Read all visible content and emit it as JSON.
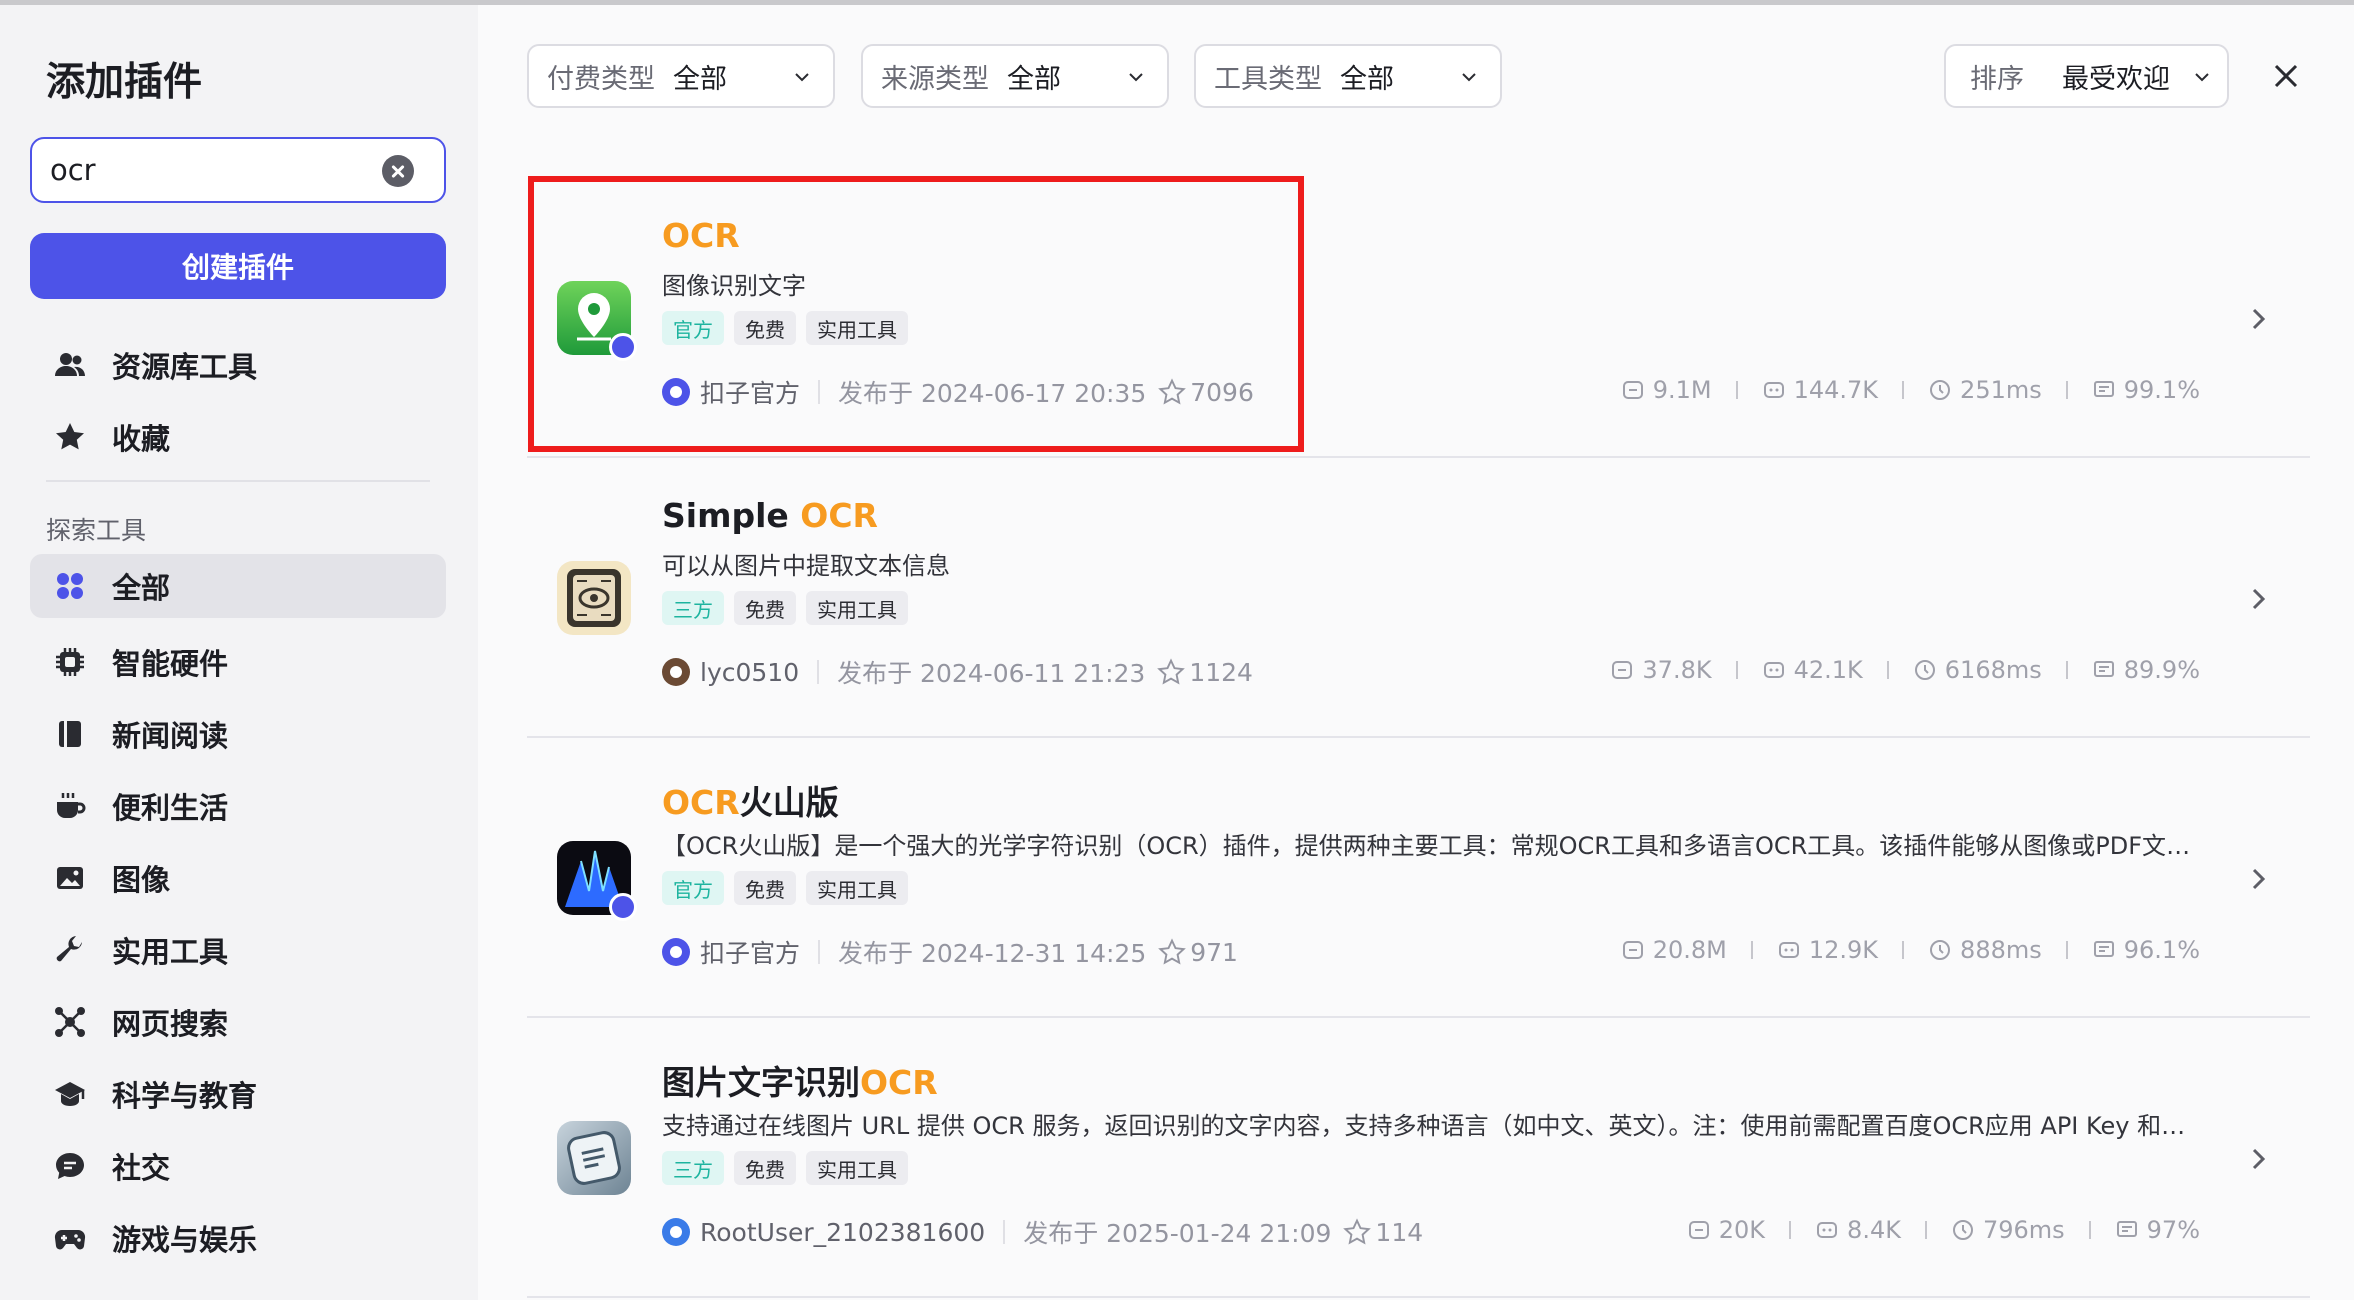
{
  "sidebar": {
    "title": "添加插件",
    "search": {
      "value": "ocr",
      "placeholder": ""
    },
    "create_button": "创建插件",
    "top_items": [
      {
        "label": "资源库工具",
        "icon": "users-icon"
      },
      {
        "label": "收藏",
        "icon": "star-icon"
      }
    ],
    "section_label": "探索工具",
    "explore_items": [
      {
        "label": "全部",
        "icon": "grid-icon",
        "active": true
      },
      {
        "label": "智能硬件",
        "icon": "chip-icon"
      },
      {
        "label": "新闻阅读",
        "icon": "book-icon"
      },
      {
        "label": "便利生活",
        "icon": "cup-icon"
      },
      {
        "label": "图像",
        "icon": "image-icon"
      },
      {
        "label": "实用工具",
        "icon": "wrench-icon"
      },
      {
        "label": "网页搜索",
        "icon": "network-icon"
      },
      {
        "label": "科学与教育",
        "icon": "graduation-cap-icon"
      },
      {
        "label": "社交",
        "icon": "chat-icon"
      },
      {
        "label": "游戏与娱乐",
        "icon": "gamepad-icon"
      }
    ]
  },
  "filters": {
    "pay": {
      "label": "付费类型",
      "value": "全部"
    },
    "source": {
      "label": "来源类型",
      "value": "全部"
    },
    "tool": {
      "label": "工具类型",
      "value": "全部"
    },
    "sort": {
      "label": "排序",
      "value": "最受欢迎"
    }
  },
  "plugins": [
    {
      "title_pre": "",
      "title_hl": "OCR",
      "title_post": "",
      "desc": "图像识别文字",
      "tags": [
        "官方",
        "免费",
        "实用工具"
      ],
      "author": "扣子官方",
      "published": "发布于 2024-06-17 20:35",
      "stars": "7096",
      "stats": [
        "9.1M",
        "144.7K",
        "251ms",
        "99.1%"
      ]
    },
    {
      "title_pre": "Simple ",
      "title_hl": "OCR",
      "title_post": "",
      "desc": "可以从图片中提取文本信息",
      "tags": [
        "三方",
        "免费",
        "实用工具"
      ],
      "author": "lyc0510",
      "published": "发布于 2024-06-11 21:23",
      "stars": "1124",
      "stats": [
        "37.8K",
        "42.1K",
        "6168ms",
        "89.9%"
      ]
    },
    {
      "title_pre": "",
      "title_hl": "OCR",
      "title_post": "火山版",
      "desc": "【OCR火山版】是一个强大的光学字符识别（OCR）插件，提供两种主要工具：常规OCR工具和多语言OCR工具。该插件能够从图像或PDF文件中识别文字",
      "tags": [
        "官方",
        "免费",
        "实用工具"
      ],
      "author": "扣子官方",
      "published": "发布于 2024-12-31 14:25",
      "stars": "971",
      "stats": [
        "20.8M",
        "12.9K",
        "888ms",
        "96.1%"
      ]
    },
    {
      "title_pre": "图片文字识别",
      "title_hl": "OCR",
      "title_post": "",
      "desc": "支持通过在线图片 URL 提供 OCR 服务，返回识别的文字内容，支持多种语言（如中文、英文）。注：使用前需配置百度OCR应用 API Key 和 Secret Key",
      "tags": [
        "三方",
        "免费",
        "实用工具"
      ],
      "author": "RootUser_2102381600",
      "published": "发布于 2025-01-24 21:09",
      "stars": "114",
      "stats": [
        "20K",
        "8.4K",
        "796ms",
        "97%"
      ]
    }
  ],
  "colors": {
    "accent": "#4d53e8",
    "highlight": "#f79b20",
    "annotation": "#ee1c1c"
  }
}
